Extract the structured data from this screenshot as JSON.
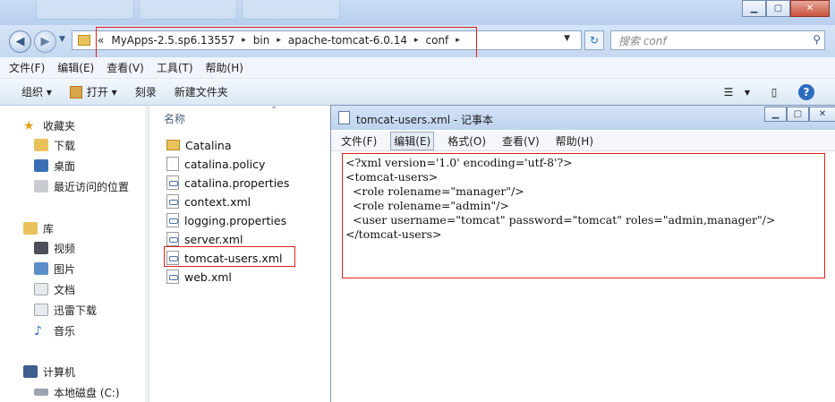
{
  "explorer": {
    "breadcrumb": [
      "«",
      "MyApps-2.5.sp6.13557",
      "▸",
      "bin",
      "▸",
      "apache-tomcat-6.0.14",
      "▸",
      "conf",
      "▸"
    ],
    "search_placeholder": "搜索 conf",
    "menu": [
      "文件(F)",
      "编辑(E)",
      "查看(V)",
      "工具(T)",
      "帮助(H)"
    ],
    "toolbar": {
      "organize": "组织 ▾",
      "open": "打开 ▾",
      "burn": "刻录",
      "new_folder": "新建文件夹"
    },
    "nav": {
      "favorites": "收藏夹",
      "downloads": "下载",
      "desktop": "桌面",
      "recent": "最近访问的位置",
      "library": "库",
      "videos": "视频",
      "pictures": "图片",
      "documents": "文档",
      "thunder": "迅雷下载",
      "music": "音乐",
      "computer": "计算机",
      "local_disk": "本地磁盘 (C:)"
    },
    "column_header": "名称",
    "files": [
      {
        "name": "Catalina",
        "type": "folder"
      },
      {
        "name": "catalina.policy",
        "type": "file"
      },
      {
        "name": "catalina.properties",
        "type": "xml"
      },
      {
        "name": "context.xml",
        "type": "xml"
      },
      {
        "name": "logging.properties",
        "type": "xml"
      },
      {
        "name": "server.xml",
        "type": "xml"
      },
      {
        "name": "tomcat-users.xml",
        "type": "xml"
      },
      {
        "name": "web.xml",
        "type": "xml"
      }
    ]
  },
  "notepad": {
    "title": "tomcat-users.xml - 记事本",
    "menu": [
      "文件(F)",
      "编辑(E)",
      "格式(O)",
      "查看(V)",
      "帮助(H)"
    ],
    "active_menu": "编辑(E)",
    "content_lines": [
      "<?xml version='1.0' encoding='utf-8'?>",
      "<tomcat-users>",
      "  <role rolename=\"manager\"/>",
      "  <role rolename=\"admin\"/>",
      "  <user username=\"tomcat\" password=\"tomcat\" roles=\"admin,manager\"/>",
      "</tomcat-users>"
    ]
  },
  "colors": {
    "highlight": "#e0201e",
    "chrome": "#c5d8f0"
  }
}
